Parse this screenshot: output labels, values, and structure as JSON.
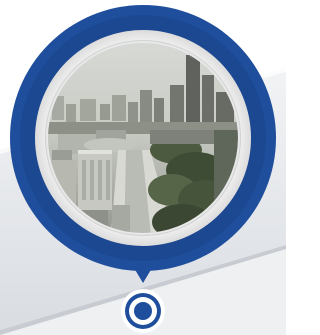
{
  "scene": {
    "subject": "city-skyline-photo-icon"
  },
  "colors": {
    "accent_blue": "#1f4f9c",
    "accent_blue_dark": "#163a78",
    "ring_white": "#ffffff",
    "panel_light": "#e9ecef",
    "panel_mid": "#d3d7dc",
    "panel_shadow": "#c3c8ce",
    "background": "#ffffff"
  }
}
